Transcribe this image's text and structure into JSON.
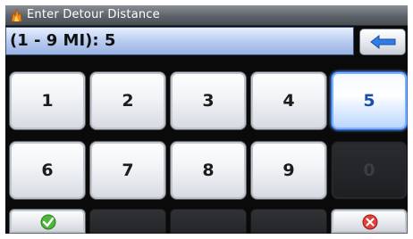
{
  "window": {
    "title": "Enter Detour Distance",
    "icon": "flame-app-icon"
  },
  "entry": {
    "value": "(1 - 9 MI): 5"
  },
  "keypad": {
    "keys": [
      "1",
      "2",
      "3",
      "4",
      "5",
      "6",
      "7",
      "8",
      "9",
      "0"
    ],
    "selected": "5",
    "disabled": [
      "0"
    ]
  },
  "actions": {
    "confirm_icon": "checkmark-icon",
    "cancel_icon": "cancel-x-icon",
    "backspace_icon": "back-arrow-icon"
  },
  "colors": {
    "accent": "#2c6ad8",
    "confirm": "#3a9a2a",
    "cancel": "#d42a2a"
  }
}
